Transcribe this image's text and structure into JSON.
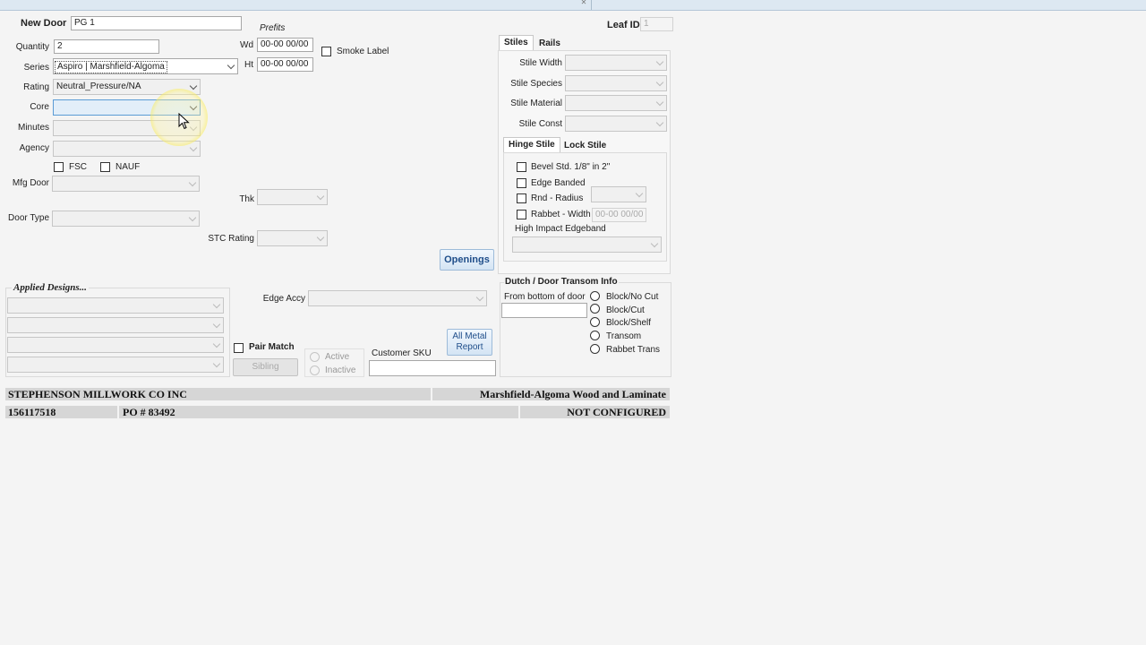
{
  "header": {
    "new_door_label": "New Door",
    "new_door_value": "PG 1",
    "prefits_label": "Prefits",
    "leaf_id_label": "Leaf ID",
    "leaf_id_value": "1"
  },
  "left": {
    "quantity_label": "Quantity",
    "quantity_value": "2",
    "series_label": "Series",
    "series_value": "Aspiro | Marshfield-Algoma",
    "rating_label": "Rating",
    "rating_value": "Neutral_Pressure/NA",
    "core_label": "Core",
    "core_value": "",
    "minutes_label": "Minutes",
    "minutes_value": "",
    "agency_label": "Agency",
    "agency_value": "",
    "fsc_label": "FSC",
    "nauf_label": "NAUF",
    "mfg_door_label": "Mfg Door",
    "mfg_door_value": "",
    "door_type_label": "Door Type",
    "door_type_value": ""
  },
  "prefits": {
    "wd_label": "Wd",
    "wd_value": "00-00 00/00",
    "ht_label": "Ht",
    "ht_value": "00-00 00/00",
    "smoke_label": "Smoke Label",
    "thk_label": "Thk",
    "thk_value": "",
    "stc_label": "STC Rating",
    "stc_value": "",
    "openings_button": "Openings"
  },
  "stiles_panel": {
    "tabs": [
      "Stiles",
      "Rails"
    ],
    "active_tab": "Stiles",
    "stile_width_label": "Stile Width",
    "stile_species_label": "Stile Species",
    "stile_material_label": "Stile Material",
    "stile_const_label": "Stile Const",
    "sub_tabs": [
      "Hinge Stile",
      "Lock Stile"
    ],
    "active_sub_tab": "Hinge Stile",
    "bevel_label": "Bevel Std. 1/8\" in 2\"",
    "edge_banded_label": "Edge Banded",
    "rnd_radius_label": "Rnd  -  Radius",
    "rabbet_width_label": "Rabbet - Width",
    "rabbet_width_value": "00-00 00/00",
    "high_impact_label": "High Impact Edgeband"
  },
  "applied_designs": {
    "title": "Applied Designs...",
    "rows": [
      "",
      "",
      "",
      ""
    ]
  },
  "edge": {
    "edge_accy_label": "Edge Accy",
    "edge_accy_value": "",
    "all_metal_report_button": "All Metal Report",
    "pair_match_label": "Pair Match",
    "sibling_button": "Sibling",
    "active_label": "Active",
    "inactive_label": "Inactive",
    "customer_sku_label": "Customer SKU",
    "customer_sku_value": ""
  },
  "transom": {
    "title": "Dutch / Door Transom Info",
    "from_bottom_label": "From bottom of door",
    "from_bottom_value": "",
    "options": [
      "Block/No Cut",
      "Block/Cut",
      "Block/Shelf",
      "Transom",
      "Rabbet Trans"
    ]
  },
  "footer": {
    "company": "STEPHENSON MILLWORK CO INC",
    "brand": "Marshfield-Algoma Wood and Laminate",
    "order_number": "156117518",
    "po": "PO # 83492",
    "status": "NOT CONFIGURED"
  },
  "colors": {
    "background": "#f4f4f4",
    "button_text": "#1f4e8a",
    "focus_field": "#e2eef9",
    "footer_strip": "#d6d6d6",
    "cursor_highlight": "#f8eb50"
  }
}
